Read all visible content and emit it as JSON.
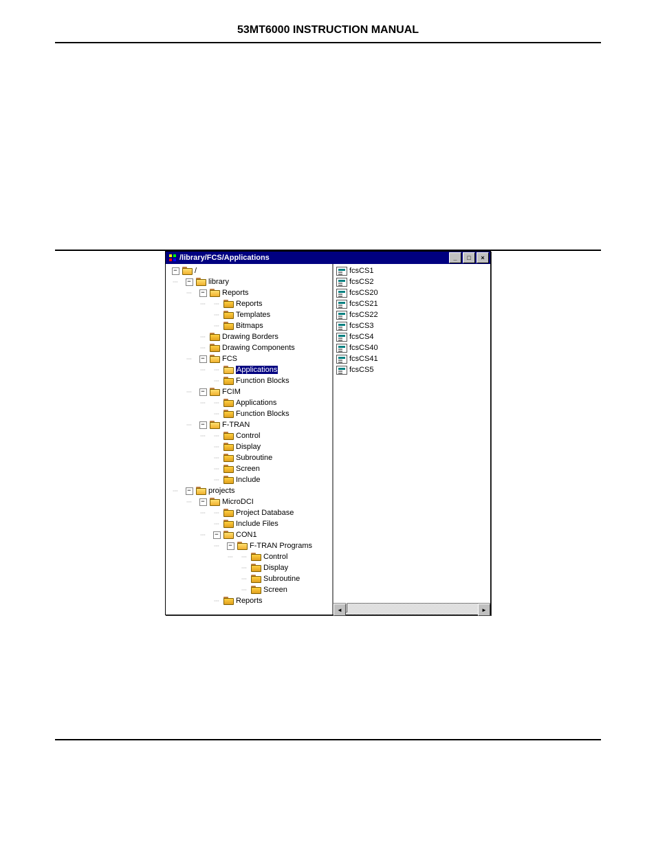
{
  "page": {
    "header": "53MT6000 INSTRUCTION MANUAL"
  },
  "window": {
    "title": "/library/FCS/Applications"
  },
  "tree": {
    "root": "/",
    "library": "library",
    "reports": "Reports",
    "reports_sub": "Reports",
    "templates": "Templates",
    "bitmaps": "Bitmaps",
    "drawing_borders": "Drawing Borders",
    "drawing_components": "Drawing Components",
    "fcs": "FCS",
    "fcs_applications": "Applications",
    "fcs_function_blocks": "Function Blocks",
    "fcim": "FCIM",
    "fcim_applications": "Applications",
    "fcim_function_blocks": "Function Blocks",
    "ftran": "F-TRAN",
    "ftran_control": "Control",
    "ftran_display": "Display",
    "ftran_subroutine": "Subroutine",
    "ftran_screen": "Screen",
    "ftran_include": "Include",
    "projects": "projects",
    "microdci": "MicroDCI",
    "project_database": "Project Database",
    "include_files": "Include Files",
    "con1": "CON1",
    "ftran_programs": "F-TRAN Programs",
    "con1_control": "Control",
    "con1_display": "Display",
    "con1_subroutine": "Subroutine",
    "con1_screen": "Screen",
    "con1_reports": "Reports"
  },
  "files": [
    "fcsCS1",
    "fcsCS2",
    "fcsCS20",
    "fcsCS21",
    "fcsCS22",
    "fcsCS3",
    "fcsCS4",
    "fcsCS40",
    "fcsCS41",
    "fcsCS5"
  ]
}
